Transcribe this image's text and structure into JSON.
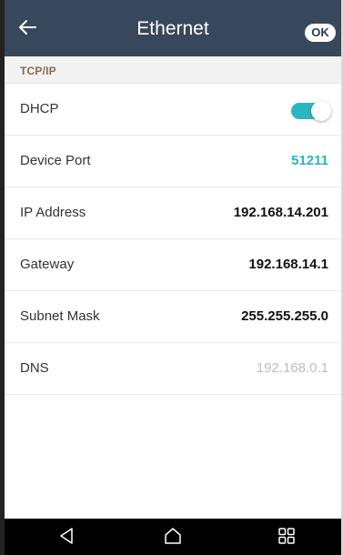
{
  "appbar": {
    "title": "Ethernet",
    "ok_label": "OK",
    "back_icon": "arrow-left-icon"
  },
  "section": {
    "title": "TCP/IP"
  },
  "settings": [
    {
      "label": "DHCP",
      "type": "toggle",
      "enabled": true
    },
    {
      "label": "Device Port",
      "value": "51211"
    },
    {
      "label": "IP Address",
      "value": "192.168.14.201"
    },
    {
      "label": "Gateway",
      "value": "192.168.14.1"
    },
    {
      "label": "Subnet Mask",
      "value": "255.255.255.0"
    },
    {
      "label": "DNS",
      "value": "192.168.0.1"
    }
  ],
  "colors": {
    "appbar_bg": "#37475c",
    "accent": "#2bb5c3",
    "section_text": "#8a6a45",
    "muted_value": "#bdbdbd"
  },
  "navbar": {
    "icons": [
      "back-triangle-icon",
      "home-icon",
      "recent-apps-icon"
    ]
  }
}
